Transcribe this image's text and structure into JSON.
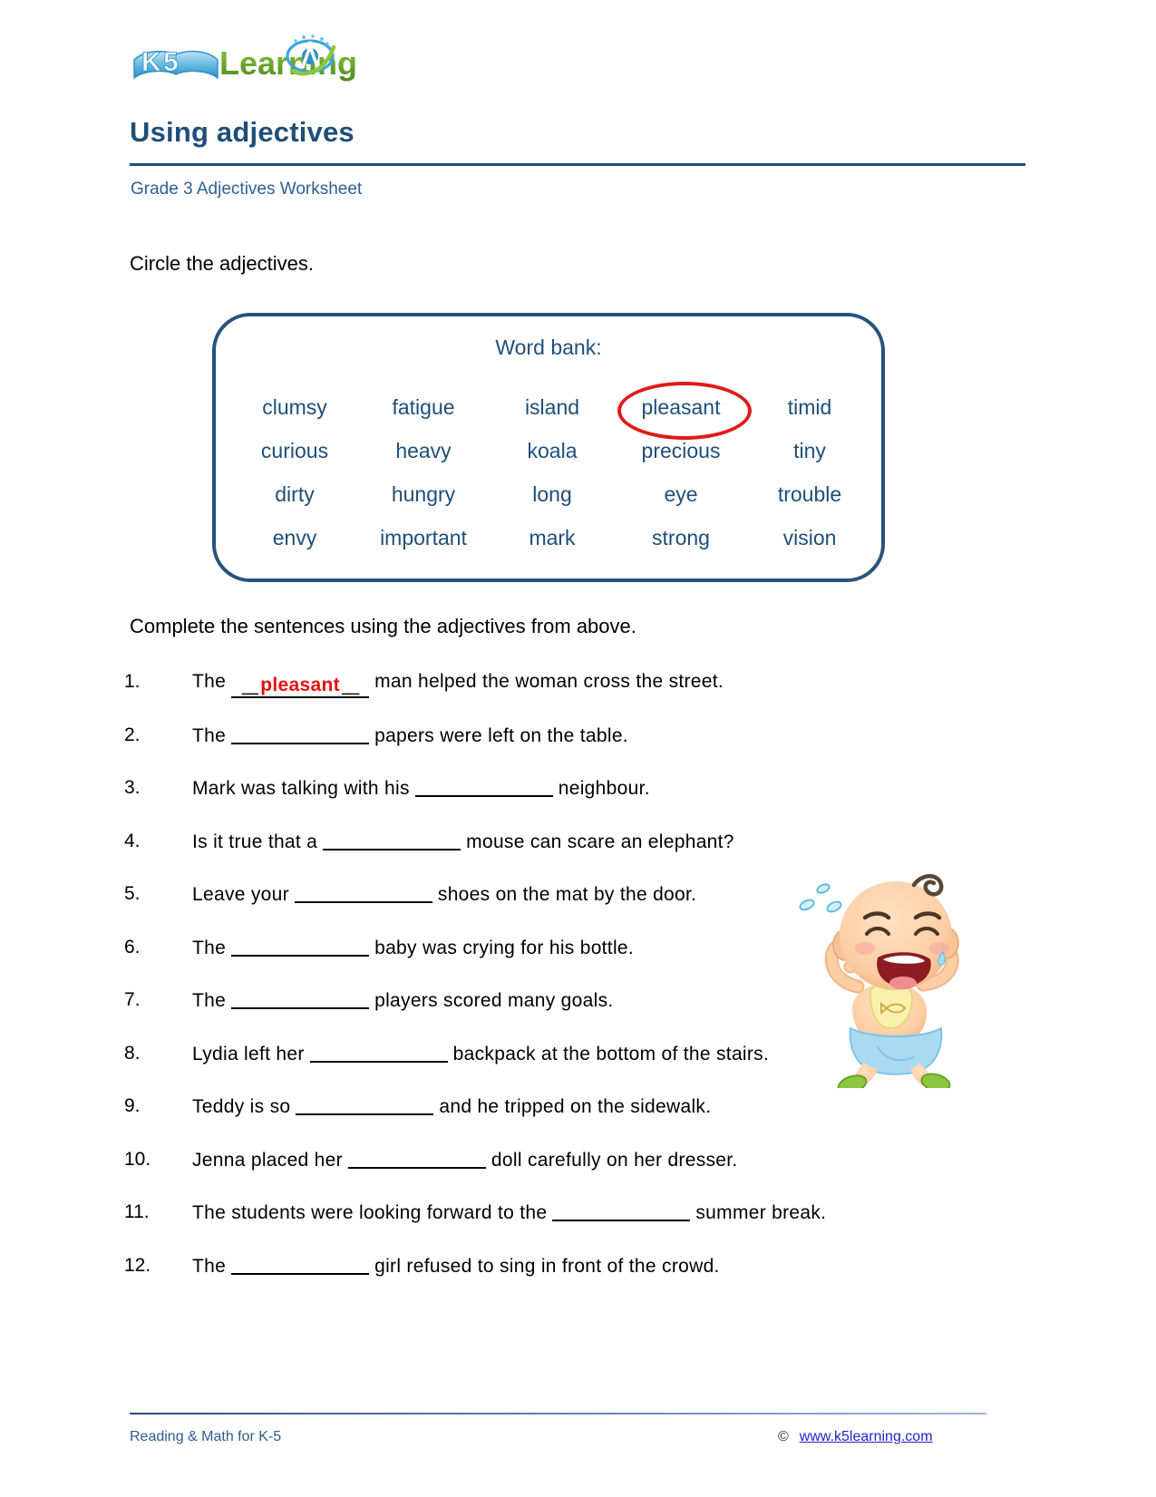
{
  "brand": {
    "logo_alt": "K5 Learning",
    "logo_k5": "K5",
    "logo_word": "Learning"
  },
  "header": {
    "title": "Using adjectives",
    "subtitle": "Grade 3 Adjectives Worksheet"
  },
  "instructions": {
    "first": "Circle the adjectives.",
    "second": "Complete the sentences using the adjectives from above."
  },
  "word_bank": {
    "heading": "Word bank:",
    "circled_word": "pleasant",
    "circle_color": "#E01B16",
    "text_color": "#1F4E79",
    "rows": [
      [
        "clumsy",
        "fatigue",
        "island",
        "pleasant",
        "timid"
      ],
      [
        "curious",
        "heavy",
        "koala",
        "precious",
        "tiny"
      ],
      [
        "dirty",
        "hungry",
        "long",
        "eye",
        "trouble"
      ],
      [
        "envy",
        "important",
        "mark",
        "strong",
        "vision"
      ]
    ]
  },
  "sentences": [
    {
      "number": "1.",
      "before": "The",
      "answer": "pleasant",
      "after": "man helped the woman cross the street."
    },
    {
      "number": "2.",
      "before": "The",
      "answer": "",
      "after": "papers were left on the table."
    },
    {
      "number": "3.",
      "before": "Mark was talking with his",
      "answer": "",
      "after": "neighbour."
    },
    {
      "number": "4.",
      "before": "Is it true that a",
      "answer": "",
      "after": "mouse can scare an elephant?"
    },
    {
      "number": "5.",
      "before": "Leave your",
      "answer": "",
      "after": "shoes on the mat by the door."
    },
    {
      "number": "6.",
      "before": "The",
      "answer": "",
      "after": "baby was crying for his bottle."
    },
    {
      "number": "7.",
      "before": "The",
      "answer": "",
      "after": "players scored many goals."
    },
    {
      "number": "8.",
      "before": "Lydia left her",
      "answer": "",
      "after": "backpack at the bottom of the stairs."
    },
    {
      "number": "9.",
      "before": "Teddy is so",
      "answer": "",
      "after": "and he tripped on the sidewalk."
    },
    {
      "number": "10.",
      "before": "Jenna placed her",
      "answer": "",
      "after": "doll carefully on her dresser."
    },
    {
      "number": "11.",
      "before": "The students were looking forward to the",
      "answer": "",
      "after": "summer break."
    },
    {
      "number": "12.",
      "before": "The",
      "answer": "",
      "after": "girl refused to sing in front of the crowd."
    }
  ],
  "illustration": {
    "name": "crying-baby-illustration"
  },
  "footer": {
    "left": "Reading & Math for K-5",
    "copyright": "©",
    "url": "www.k5learning.com"
  }
}
